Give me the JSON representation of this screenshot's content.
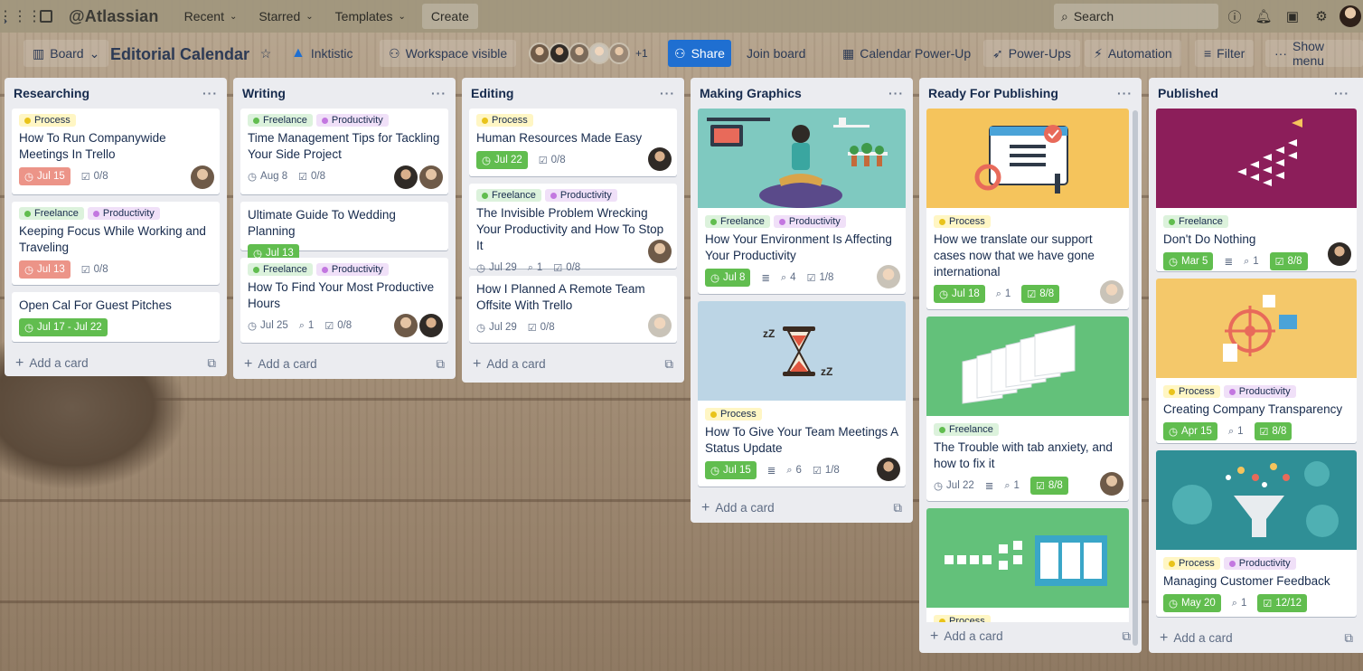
{
  "topnav": {
    "brand": "@Atlassian",
    "recent": "Recent",
    "starred": "Starred",
    "templates": "Templates",
    "create": "Create",
    "search_label": "Search"
  },
  "board": {
    "view": "Board",
    "name": "Editorial Calendar",
    "workspace": "Inktistic",
    "visibility": "Workspace visible",
    "extra_members": "+1",
    "share": "Share",
    "join": "Join board",
    "calendar": "Calendar Power-Up",
    "powerups": "Power-Ups",
    "automation": "Automation",
    "filter": "Filter",
    "show_menu": "Show menu"
  },
  "add_card": "Add a card",
  "lists": [
    {
      "title": "Researching",
      "cards": [
        {
          "labels": [
            "Process"
          ],
          "title": "How To Run Companywide Meetings In Trello",
          "date": "Jul 15",
          "checklist": "0/8"
        },
        {
          "labels": [
            "Freelance",
            "Productivity"
          ],
          "title": "Keeping Focus While Working and Traveling",
          "date": "Jul 13",
          "checklist": "0/8"
        },
        {
          "title": "Open Cal For Guest Pitches",
          "date": "Jul 17 - Jul 22"
        }
      ]
    },
    {
      "title": "Writing",
      "cards": [
        {
          "labels": [
            "Freelance",
            "Productivity"
          ],
          "title": "Time Management Tips for Tackling Your Side Project",
          "date": "Aug 8",
          "checklist": "0/8"
        },
        {
          "title": "Ultimate Guide To Wedding Planning",
          "date": "Jul 13"
        },
        {
          "labels": [
            "Freelance",
            "Productivity"
          ],
          "title": "How To Find Your Most Productive Hours",
          "date": "Jul 25",
          "attachments": "1",
          "checklist": "0/8"
        }
      ]
    },
    {
      "title": "Editing",
      "cards": [
        {
          "labels": [
            "Process"
          ],
          "title": "Human Resources Made Easy",
          "date": "Jul 22",
          "checklist": "0/8"
        },
        {
          "labels": [
            "Freelance",
            "Productivity"
          ],
          "title": "The Invisible Problem Wrecking Your Productivity and How To Stop It",
          "date": "Jul 29",
          "attachments": "1",
          "checklist": "0/8"
        },
        {
          "title": "How I Planned A Remote Team Offsite With Trello",
          "date": "Jul 29",
          "checklist": "0/8"
        }
      ]
    },
    {
      "title": "Making Graphics",
      "cards": [
        {
          "labels": [
            "Freelance",
            "Productivity"
          ],
          "title": "How Your Environment Is Affecting Your Productivity",
          "date": "Jul 8",
          "attachments": "4",
          "checklist": "1/8"
        },
        {
          "labels": [
            "Process"
          ],
          "title": "How To Give Your Team Meetings A Status Update",
          "date": "Jul 15",
          "attachments": "6",
          "checklist": "1/8"
        }
      ]
    },
    {
      "title": "Ready For Publishing",
      "cards": [
        {
          "labels": [
            "Process"
          ],
          "title": "How we translate our support cases now that we have gone international",
          "date": "Jul 18",
          "attachments": "1",
          "checklist": "8/8"
        },
        {
          "labels": [
            "Freelance"
          ],
          "title": "The Trouble with tab anxiety, and how to fix it",
          "date": "Jul 22",
          "attachments": "1",
          "checklist": "8/8"
        },
        {
          "labels": [
            "Process"
          ]
        }
      ]
    },
    {
      "title": "Published",
      "cards": [
        {
          "labels": [
            "Freelance"
          ],
          "title": "Don't Do Nothing",
          "date": "Mar 5",
          "attachments": "1",
          "checklist": "8/8"
        },
        {
          "labels": [
            "Process",
            "Productivity"
          ],
          "title": "Creating Company Transparency",
          "date": "Apr 15",
          "attachments": "1",
          "checklist": "8/8"
        },
        {
          "labels": [
            "Process",
            "Productivity"
          ],
          "title": "Managing Customer Feedback",
          "date": "May 20",
          "attachments": "1",
          "checklist": "12/12"
        }
      ]
    }
  ],
  "colors": {
    "due_overdue": "#ec9488",
    "due_complete": "#61bd4f",
    "share": "#1f6fd1",
    "cover_teal": "#7fc9c0",
    "cover_blue": "#bcd5e5",
    "cover_yellow": "#f5c45c",
    "cover_green": "#63c17a",
    "cover_magenta": "#8c1e5a",
    "cover_gold": "#f4c86a",
    "cover_sea": "#2f8f96"
  }
}
